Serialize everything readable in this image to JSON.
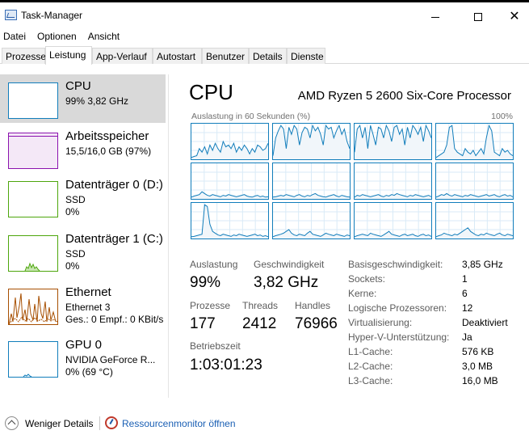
{
  "window": {
    "title": "Task-Manager"
  },
  "menu": [
    "Datei",
    "Optionen",
    "Ansicht"
  ],
  "tabs": [
    "Prozesse",
    "Leistung",
    "App-Verlauf",
    "Autostart",
    "Benutzer",
    "Details",
    "Dienste"
  ],
  "active_tab": "Leistung",
  "resources": [
    {
      "name": "CPU",
      "sub1": "99% 3,82 GHz",
      "sub2": "",
      "color": "#117dbb",
      "selected": true
    },
    {
      "name": "Arbeitsspeicher",
      "sub1": "15,5/16,0 GB (97%)",
      "sub2": "",
      "color": "#8b12ae",
      "selected": false
    },
    {
      "name": "Datenträger 0 (D:)",
      "sub1": "SSD",
      "sub2": "0%",
      "color": "#4da60c",
      "selected": false
    },
    {
      "name": "Datenträger 1 (C:)",
      "sub1": "SSD",
      "sub2": "0%",
      "color": "#4da60c",
      "selected": false
    },
    {
      "name": "Ethernet",
      "sub1": "Ethernet 3",
      "sub2": "Ges.: 0 Empf.: 0 KBit/s",
      "color": "#a74f01",
      "selected": false
    },
    {
      "name": "GPU 0",
      "sub1": "NVIDIA GeForce R...",
      "sub2": "0% (69 °C)",
      "color": "#117dbb",
      "selected": false
    }
  ],
  "detail": {
    "title": "CPU",
    "processor": "AMD Ryzen 5 2600 Six-Core Processor",
    "graph_caption": "Auslastung in 60 Sekunden (%)",
    "graph_max": "100%",
    "stats": {
      "auslastung_label": "Auslastung",
      "auslastung_value": "99%",
      "geschwindigkeit_label": "Geschwindigkeit",
      "geschwindigkeit_value": "3,82 GHz",
      "prozesse_label": "Prozesse",
      "prozesse_value": "177",
      "threads_label": "Threads",
      "threads_value": "2412",
      "handles_label": "Handles",
      "handles_value": "76966",
      "betriebszeit_label": "Betriebszeit",
      "betriebszeit_value": "1:03:01:23"
    },
    "info": [
      {
        "label": "Basisgeschwindigkeit:",
        "value": "3,85 GHz"
      },
      {
        "label": "Sockets:",
        "value": "1"
      },
      {
        "label": "Kerne:",
        "value": "6"
      },
      {
        "label": "Logische Prozessoren:",
        "value": "12"
      },
      {
        "label": "Virtualisierung:",
        "value": "Deaktiviert"
      },
      {
        "label": "Hyper-V-Unterstützung:",
        "value": "Ja"
      },
      {
        "label": "L1-Cache:",
        "value": "576 KB"
      },
      {
        "label": "L2-Cache:",
        "value": "3,0 MB"
      },
      {
        "label": "L3-Cache:",
        "value": "16,0 MB"
      }
    ],
    "core_graph_color": "#117dbb",
    "core_graphs": [
      [
        5,
        8,
        10,
        30,
        20,
        35,
        15,
        40,
        25,
        45,
        30,
        20,
        50,
        35,
        40,
        30,
        45,
        20,
        35,
        25,
        40,
        30,
        15,
        30,
        20,
        40,
        35,
        25,
        30,
        45
      ],
      [
        10,
        60,
        80,
        95,
        85,
        30,
        90,
        70,
        95,
        85,
        40,
        75,
        90,
        85,
        60,
        95,
        80,
        90,
        70,
        40,
        95,
        85,
        90,
        60,
        80,
        95,
        70,
        85,
        50,
        30
      ],
      [
        20,
        85,
        95,
        60,
        90,
        30,
        95,
        70,
        40,
        90,
        85,
        60,
        95,
        80,
        50,
        90,
        95,
        70,
        85,
        40,
        90,
        60,
        95,
        85,
        70,
        90,
        50,
        95,
        80,
        60
      ],
      [
        5,
        10,
        15,
        20,
        40,
        90,
        95,
        30,
        20,
        15,
        10,
        30,
        20,
        15,
        25,
        10,
        20,
        30,
        15,
        60,
        95,
        80,
        20,
        15,
        10,
        30,
        20,
        25,
        15,
        10
      ],
      [
        5,
        8,
        10,
        12,
        20,
        15,
        10,
        8,
        12,
        10,
        8,
        6,
        10,
        8,
        12,
        10,
        8,
        6,
        8,
        10,
        12,
        8,
        6,
        5,
        8,
        10,
        6,
        8,
        5,
        6
      ],
      [
        5,
        6,
        8,
        10,
        8,
        12,
        10,
        8,
        6,
        10,
        12,
        8,
        6,
        10,
        8,
        12,
        15,
        10,
        8,
        6,
        5,
        8,
        10,
        12,
        8,
        6,
        10,
        8,
        6,
        5
      ],
      [
        5,
        10,
        8,
        12,
        10,
        8,
        6,
        8,
        10,
        12,
        8,
        6,
        10,
        8,
        12,
        10,
        15,
        12,
        10,
        8,
        6,
        10,
        8,
        12,
        10,
        8,
        6,
        8,
        10,
        6
      ],
      [
        5,
        8,
        12,
        10,
        15,
        10,
        8,
        12,
        10,
        8,
        6,
        10,
        8,
        12,
        10,
        8,
        6,
        8,
        10,
        12,
        8,
        10,
        12,
        8,
        6,
        10,
        12,
        8,
        10,
        6
      ],
      [
        5,
        6,
        8,
        10,
        12,
        95,
        90,
        40,
        20,
        15,
        10,
        8,
        12,
        10,
        8,
        6,
        10,
        8,
        12,
        10,
        8,
        6,
        8,
        10,
        12,
        8,
        10,
        6,
        8,
        5
      ],
      [
        5,
        8,
        10,
        12,
        15,
        20,
        25,
        15,
        10,
        8,
        12,
        10,
        8,
        15,
        20,
        12,
        10,
        8,
        6,
        10,
        15,
        12,
        10,
        8,
        12,
        10,
        8,
        6,
        10,
        8
      ],
      [
        5,
        8,
        10,
        12,
        10,
        8,
        15,
        12,
        10,
        8,
        6,
        10,
        15,
        20,
        12,
        10,
        8,
        6,
        10,
        12,
        8,
        10,
        12,
        8,
        6,
        10,
        12,
        8,
        10,
        6
      ],
      [
        5,
        8,
        10,
        15,
        12,
        10,
        8,
        12,
        10,
        15,
        20,
        25,
        30,
        20,
        15,
        10,
        8,
        12,
        10,
        15,
        12,
        10,
        8,
        12,
        15,
        10,
        8,
        12,
        10,
        8
      ]
    ]
  },
  "footer": {
    "less_label": "Weniger Details",
    "resmon_label": "Ressourcenmonitor öffnen"
  }
}
